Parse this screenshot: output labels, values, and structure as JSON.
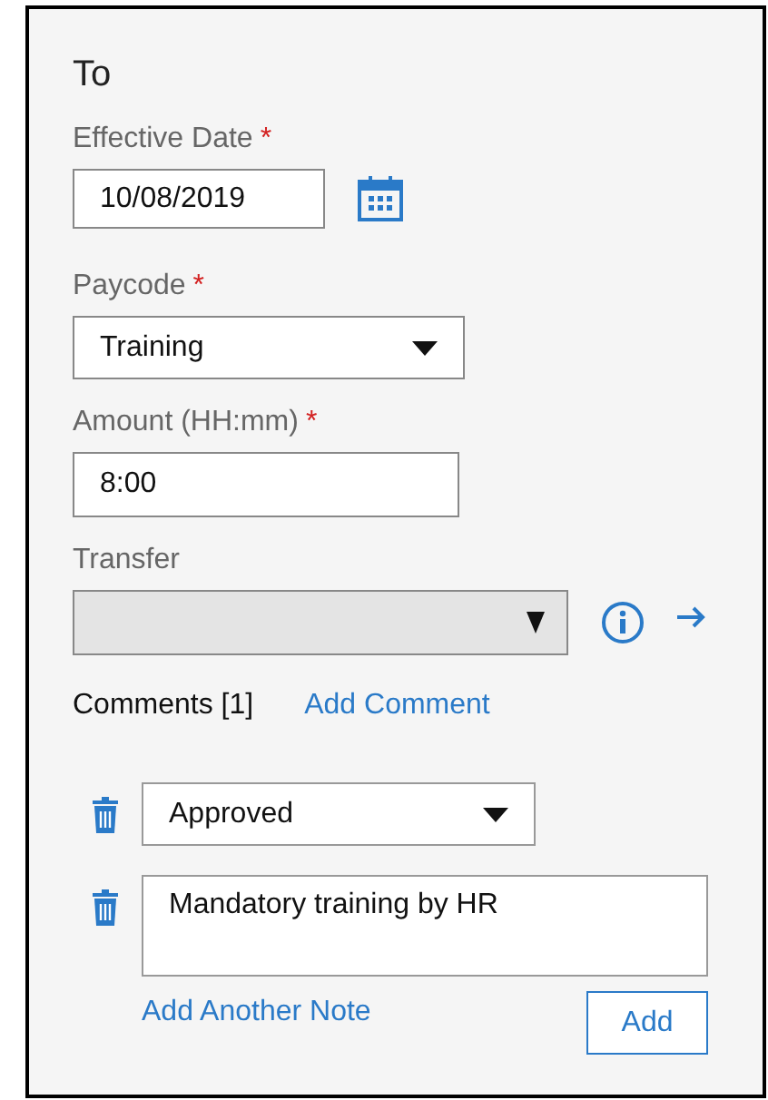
{
  "heading": "To",
  "fields": [
    {
      "kind": "date",
      "label": "Effective Date",
      "required_mark": "*",
      "value": "10/08/2019"
    },
    {
      "kind": "select",
      "label": "Paycode",
      "required_mark": "*",
      "value": "Training"
    },
    {
      "kind": "text",
      "label": "Amount (HH:mm)",
      "required_mark": "*",
      "value": "8:00"
    },
    {
      "kind": "transfer",
      "label": "Transfer",
      "disabled": true
    }
  ],
  "comments": {
    "title": "Comments [1]",
    "add_link": "Add Comment",
    "comment": "Approved",
    "note": "Mandatory training by HR",
    "add_note_link": "Add Another Note",
    "add_button": "Add"
  }
}
